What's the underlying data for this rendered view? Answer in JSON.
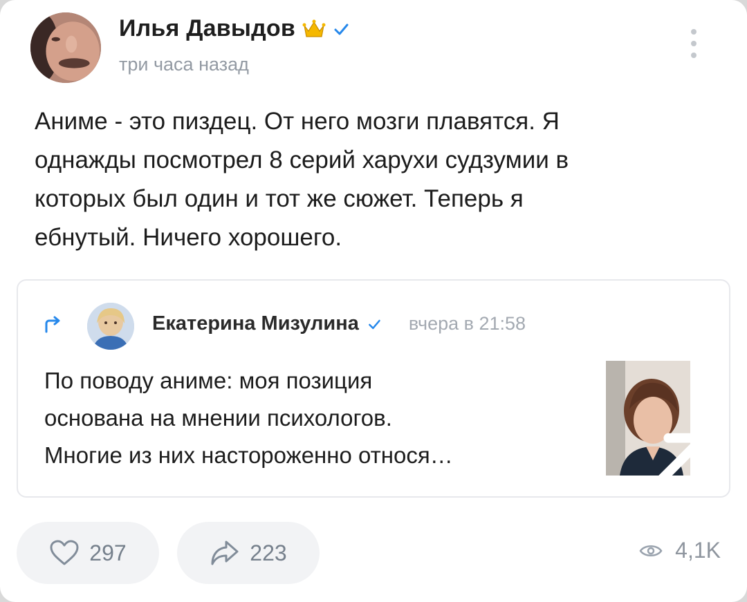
{
  "post": {
    "author": "Илья Давыдов",
    "time": "три часа назад",
    "text": "Аниме - это пиздец. От него мозги плавятся. Я\nоднажды посмотрел 8 серий харухи судзумии в\nкоторых был один и тот же сюжет. Теперь я\nебнутый. Ничего хорошего.",
    "icons": {
      "crown": "crown-icon",
      "verified": "verified-check-icon",
      "more": "more-vertical-icon"
    }
  },
  "repost": {
    "author": "Екатерина Мизулина",
    "time": "вчера в 21:58",
    "text": "По поводу аниме: моя позиция\nоснована на мнении психологов.\nМногие из них настороженно относя…",
    "icons": {
      "repost": "repost-arrow-icon",
      "expand": "expand-arrow-icon"
    }
  },
  "actions": {
    "likes": "297",
    "shares": "223",
    "views": "4,1K"
  },
  "colors": {
    "accent": "#2688eb",
    "muted": "#939aa3",
    "pill_bg": "#f2f3f5",
    "crown": "#f5b800"
  }
}
